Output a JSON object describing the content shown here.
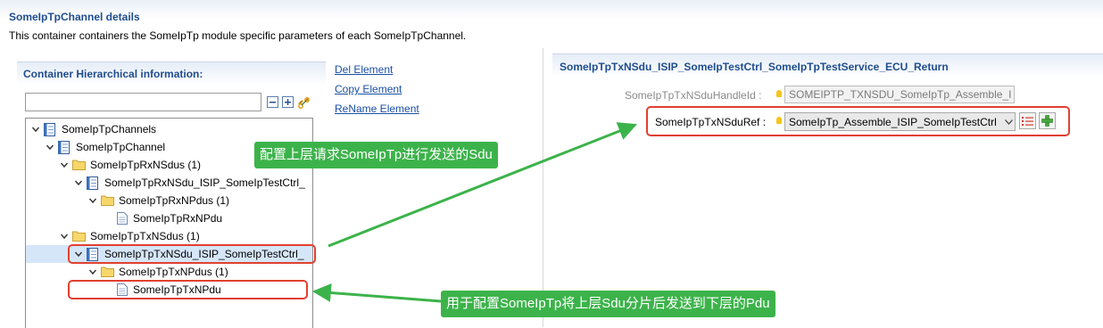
{
  "header": {
    "title": "SomeIpTpChannel details",
    "description": "This container containers the SomeIpTp module specific parameters of each SomeIpTpChannel."
  },
  "hierarchy": {
    "title": "Container Hierarchical information:",
    "search_value": "",
    "toolbar": {
      "collapse_icon": "collapse-all-icon",
      "expand_icon": "expand-all-icon",
      "link_icon": "link-editor-icon"
    },
    "tree": [
      {
        "label": "SomeIpTpChannels",
        "icon": "container-icon"
      },
      {
        "label": "SomeIpTpChannel",
        "icon": "container-icon"
      },
      {
        "label": "SomeIpTpRxNSdus (1)",
        "icon": "folder-icon"
      },
      {
        "label": "SomeIpTpRxNSdu_ISIP_SomeIpTestCtrl_",
        "icon": "container-icon"
      },
      {
        "label": "SomeIpTpRxNPdus (1)",
        "icon": "folder-icon"
      },
      {
        "label": "SomeIpTpRxNPdu",
        "icon": "document-icon"
      },
      {
        "label": "SomeIpTpTxNSdus (1)",
        "icon": "folder-icon"
      },
      {
        "label": "SomeIpTpTxNSdu_ISIP_SomeIpTestCtrl_",
        "icon": "container-icon",
        "selected": true
      },
      {
        "label": "SomeIpTpTxNPdus (1)",
        "icon": "folder-icon"
      },
      {
        "label": "SomeIpTpTxNPdu",
        "icon": "document-icon"
      }
    ]
  },
  "actions": {
    "del": "Del Element",
    "copy": "Copy Element",
    "rename": "ReName Element"
  },
  "details": {
    "title": "SomeIpTpTxNSdu_ISIP_SomeIpTestCtrl_SomeIpTpTestService_ECU_Return",
    "handle_id_label": "SomeIpTpTxNSduHandleId :",
    "handle_id_value": "SOMEIPTP_TXNSDU_SomeIpTp_Assemble_I",
    "ref_label": "SomeIpTpTxNSduRef :",
    "ref_value": "SomeIpTp_Assemble_ISIP_SomeIpTestCtrl"
  },
  "annotations": {
    "callout_ref": "配置上层请求SomeIpTp进行发送的Sdu",
    "callout_pdu": "用于配置SomeIpTp将上层Sdu分片后发送到下层的Pdu",
    "color": "#3cb34a",
    "highlight_color": "#e04030"
  }
}
